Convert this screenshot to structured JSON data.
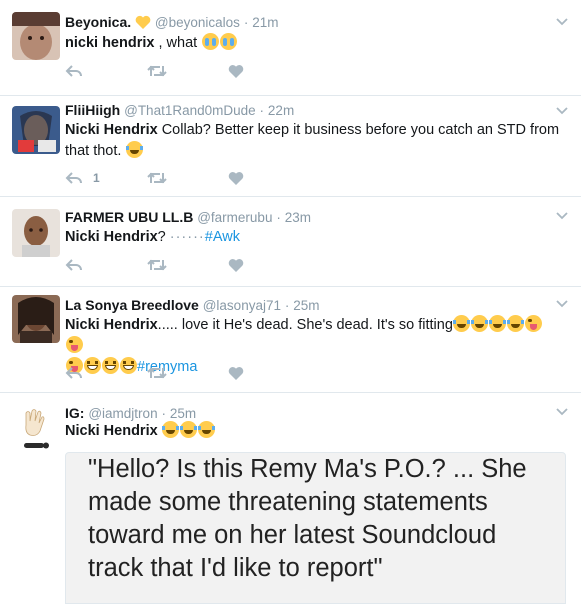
{
  "tweets": [
    {
      "name": "Beyonica.",
      "handle": "@beyonicalos",
      "time": "21m",
      "mention": "nicki hendrix",
      "text": " , what",
      "reply_count": "",
      "avatar_colors": [
        "#c9a18a",
        "#5a3d33"
      ]
    },
    {
      "name": "FliiHiigh",
      "handle": "@That1Rand0mDude",
      "time": "22m",
      "mention": "Nicki Hendrix",
      "text": " Collab? Better keep it business before you catch an STD from that thot.",
      "reply_count": "1",
      "avatar_colors": [
        "#3b5b8c",
        "#d9cfc8"
      ]
    },
    {
      "name": "FARMER UBU LL.B",
      "handle": "@farmerubu",
      "time": "23m",
      "mention": "Nicki Hendrix",
      "text": "? ",
      "eyes": "······",
      "hashtag": "#Awk",
      "reply_count": "",
      "avatar_colors": [
        "#a57a5c",
        "#e8e2dc"
      ]
    },
    {
      "name": "La Sonya Breedlove",
      "handle": "@lasonyaj71",
      "time": "25m",
      "mention": "Nicki Hendrix",
      "text": "..... love it He's dead. She's dead. It's so fitting",
      "hashtag": "#remyma",
      "reply_count": "",
      "avatar_colors": [
        "#3a2a22",
        "#8b6a55"
      ]
    },
    {
      "name": "IG:",
      "handle": "@iamdjtron",
      "time": "25m",
      "mention": "Nicki Hendrix",
      "text": "",
      "reply_count": "",
      "avatar_colors": [
        "#ffffff",
        "#2b2b2b"
      ]
    }
  ],
  "media": {
    "quote": "\"Hello? Is this Remy Ma's P.O.? ... She made some threatening statements toward me on her latest Soundcloud track that I'd like to report\""
  },
  "icons": {
    "reply": "reply-icon",
    "retweet": "retweet-icon",
    "like": "heart-icon",
    "caret": "chevron-down-icon"
  },
  "colors": {
    "meta": "#8899a6",
    "hashtag": "#1b95e0",
    "icon": "#aab8c2",
    "divider": "#e1e8ed"
  }
}
